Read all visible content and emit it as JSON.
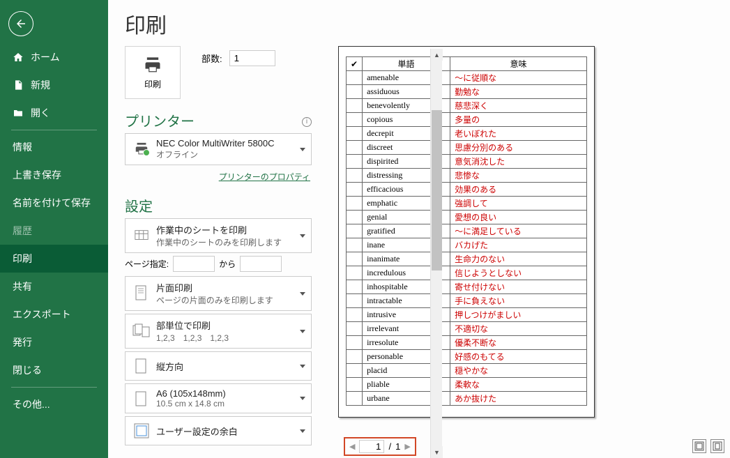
{
  "title": "印刷",
  "nav": {
    "home": "ホーム",
    "new": "新規",
    "open": "開く",
    "info": "情報",
    "save": "上書き保存",
    "saveas": "名前を付けて保存",
    "history": "履歴",
    "print": "印刷",
    "share": "共有",
    "export": "エクスポート",
    "publish": "発行",
    "close": "閉じる",
    "other": "その他..."
  },
  "print_button": "印刷",
  "copies_label": "部数:",
  "copies_value": "1",
  "printer_section": "プリンター",
  "printer_name": "NEC Color MultiWriter 5800C",
  "printer_status": "オフライン",
  "printer_props_link": "プリンターのプロパティ",
  "settings_section": "設定",
  "opts": {
    "sheets_title": "作業中のシートを印刷",
    "sheets_sub": "作業中のシートのみを印刷します",
    "range_label": "ページ指定:",
    "range_sep": "から",
    "side_title": "片面印刷",
    "side_sub": "ページの片面のみを印刷します",
    "collate_title": "部単位で印刷",
    "collate_sub": "1,2,3　1,2,3　1,2,3",
    "orient_title": "縦方向",
    "paper_title": "A6 (105x148mm)",
    "paper_sub": "10.5 cm x 14.8 cm",
    "margin_title": "ユーザー設定の余白"
  },
  "pager": {
    "current": "1",
    "total": "1",
    "sep": "/"
  },
  "preview": {
    "headers": {
      "chk": "✔",
      "word": "単語",
      "mean": "意味"
    },
    "rows": [
      {
        "w": "amenable",
        "m": "〜に従順な"
      },
      {
        "w": "assiduous",
        "m": "勤勉な"
      },
      {
        "w": "benevolently",
        "m": "慈悲深く"
      },
      {
        "w": "copious",
        "m": "多量の"
      },
      {
        "w": "decrepit",
        "m": "老いぼれた"
      },
      {
        "w": "discreet",
        "m": "思慮分別のある"
      },
      {
        "w": "dispirited",
        "m": "意気消沈した"
      },
      {
        "w": "distressing",
        "m": "悲惨な"
      },
      {
        "w": "efficacious",
        "m": "効果のある"
      },
      {
        "w": "emphatic",
        "m": "強調して"
      },
      {
        "w": "genial",
        "m": "愛想の良い"
      },
      {
        "w": "gratified",
        "m": "〜に満足している"
      },
      {
        "w": "inane",
        "m": "バカげた"
      },
      {
        "w": "inanimate",
        "m": "生命力のない"
      },
      {
        "w": "incredulous",
        "m": "信じようとしない"
      },
      {
        "w": "inhospitable",
        "m": "寄せ付けない"
      },
      {
        "w": "intractable",
        "m": "手に負えない"
      },
      {
        "w": "intrusive",
        "m": "押しつけがましい"
      },
      {
        "w": "irrelevant",
        "m": "不適切な"
      },
      {
        "w": "irresolute",
        "m": "優柔不断な"
      },
      {
        "w": "personable",
        "m": "好感のもてる"
      },
      {
        "w": "placid",
        "m": "穏やかな"
      },
      {
        "w": "pliable",
        "m": "柔軟な"
      },
      {
        "w": "urbane",
        "m": "あか抜けた"
      }
    ]
  }
}
